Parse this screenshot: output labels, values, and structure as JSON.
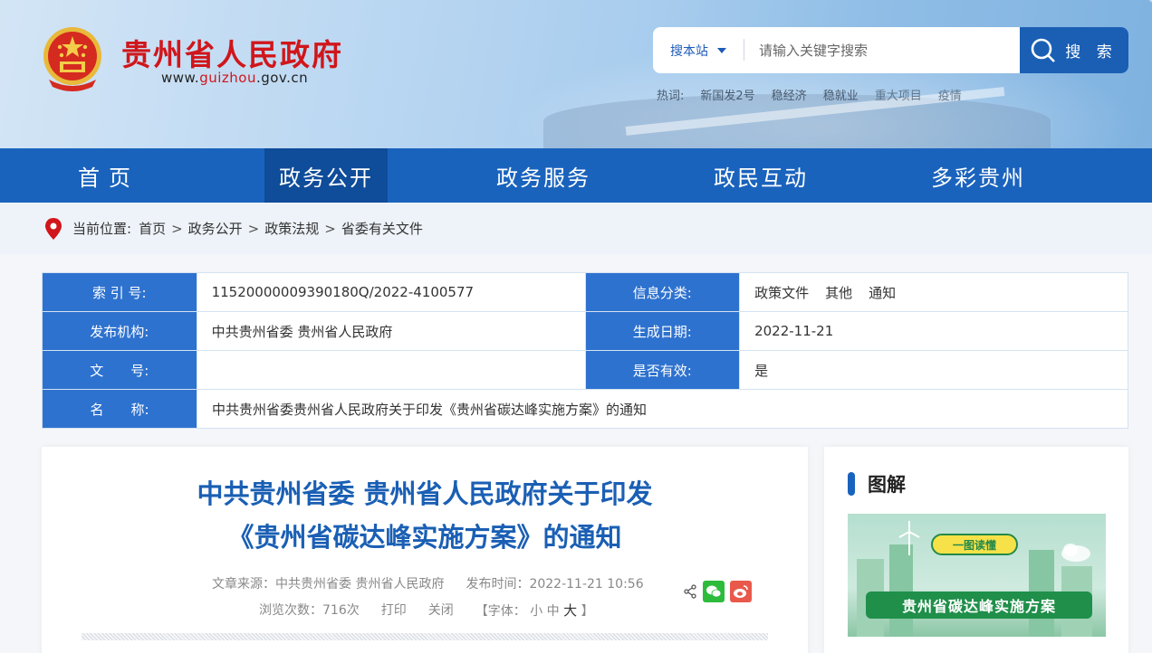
{
  "header": {
    "site_name": "贵州省人民政府",
    "url_prefix": "www.",
    "url_highlight": "guizhou",
    "url_suffix": ".gov.cn",
    "search_scope": "搜本站",
    "search_placeholder": "请输入关键字搜索",
    "search_button": "搜 索",
    "hot_label": "热词:",
    "hot_words": [
      "新国发2号",
      "稳经济",
      "稳就业",
      "重大项目",
      "疫情"
    ]
  },
  "nav": {
    "items": [
      "首页",
      "政务公开",
      "政务服务",
      "政民互动",
      "多彩贵州"
    ],
    "active": "政务公开"
  },
  "breadcrumb": {
    "label": "当前位置:",
    "items": [
      "首页",
      "政务公开",
      "政策法规",
      "省委有关文件"
    ],
    "separator": ">"
  },
  "meta": {
    "index_label": "索 引 号:",
    "index_value": "11520000009390180Q/2022-4100577",
    "category_label": "信息分类:",
    "category_values": [
      "政策文件",
      "其他",
      "通知"
    ],
    "publisher_label": "发布机构:",
    "publisher_value": "中共贵州省委 贵州省人民政府",
    "date_label": "生成日期:",
    "date_value": "2022-11-21",
    "docno_label": "文　　号:",
    "docno_value": "",
    "valid_label": "是否有效:",
    "valid_value": "是",
    "name_label": "名　　称:",
    "name_value": "中共贵州省委贵州省人民政府关于印发《贵州省碳达峰实施方案》的通知"
  },
  "article": {
    "title_line1": "中共贵州省委 贵州省人民政府关于印发",
    "title_line2": "《贵州省碳达峰实施方案》的通知",
    "source": "文章来源：中共贵州省委 贵州省人民政府",
    "pub_time": "发布时间：2022-11-21 10:56",
    "views": "浏览次数：716次",
    "print": "打印",
    "close": "关闭",
    "font_label": "【字体：",
    "font_small": "小",
    "font_mid": "中",
    "font_big": "大",
    "font_end": "】"
  },
  "sidebar": {
    "title": "图解",
    "banner": "一图读懂",
    "caption": "贵州省碳达峰实施方案"
  },
  "colors": {
    "brand_red": "#d0161b",
    "nav_blue": "#1a63bd",
    "nav_active": "#0f4c99",
    "title_blue": "#1a5fb4",
    "meta_key_bg": "#2e72cf"
  }
}
